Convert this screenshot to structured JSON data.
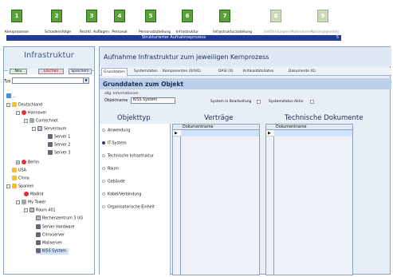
{
  "toolbar": {
    "items": [
      {
        "label": "Kernprozesse",
        "icon": "kernprozesse-icon",
        "enabled": true
      },
      {
        "label": "Schadensfolge",
        "icon": "schadensfolge-icon",
        "enabled": true
      },
      {
        "label": "Rechtl. Auflagen",
        "icon": "auflagen-icon",
        "enabled": true
      },
      {
        "label": "Personal",
        "icon": "personal-icon",
        "enabled": true
      },
      {
        "label": "Personalzuteilung",
        "icon": "personalzuteilung-icon",
        "enabled": true
      },
      {
        "label": "Infrastruktur",
        "icon": "infrastruktur-icon",
        "enabled": true
      },
      {
        "label": "Infrastrukturzuteilung",
        "icon": "infrastrukturzuteilung-icon",
        "enabled": true
      },
      {
        "label": "Gefährdungen/Maßnahmen",
        "icon": "gefaehrdungen-icon",
        "enabled": false
      },
      {
        "label": "Abhängigkeiten",
        "icon": "abhaengigkeiten-icon",
        "enabled": false
      }
    ],
    "subtitle": "Strukturierter Aufnahmeprozess",
    "corner": "5"
  },
  "left_panel": {
    "title": "Infrastruktur",
    "buttons": {
      "neu": "Neu",
      "loeschen": "Löschen",
      "speichern": "Speichern"
    },
    "typ_label": "Typ",
    "typ_value": "",
    "tree": {
      "root": "...",
      "deutschland": "Deutschland",
      "hannover": "Hannover",
      "contechnet": "Contechnet",
      "serverraum": "Serverraum",
      "server1": "Server 1",
      "server2": "Server 2",
      "server3": "Server 3",
      "berlin": "Berlin",
      "usa": "USA",
      "china": "China",
      "spanien": "Spanien",
      "madrid": "Madrid",
      "mytower": "My Tower",
      "raum401": "Raum 401",
      "rechenzentrum": "Rechenzentrum 3 UG",
      "serverhardware": "Server Hardware",
      "citrixserver": "Citrixserver",
      "mailserver": "Mailserver",
      "kiss": "KISS System"
    }
  },
  "main": {
    "title": "Aufnahme Infrastruktur zum jeweiligen Kernprozess",
    "tabs": [
      {
        "label": "Grunddaten",
        "active": true
      },
      {
        "label": "Systemdaten",
        "active": false
      },
      {
        "label": "Komponenten (0/0/0)",
        "active": false
      },
      {
        "label": "DASI (0)",
        "active": false
      },
      {
        "label": "Kritikalitätsdaten",
        "active": false
      },
      {
        "label": "Dokumente (0)",
        "active": false
      }
    ],
    "section": "Grunddaten zum Objekt",
    "allg": "allg. Informationen",
    "objektname_label": "Objektname",
    "objektname_value": "KISS System",
    "in_bearbeitung": "System in Bearbeitung",
    "status_aktiv": "Systemstatus Aktiv",
    "objekttyp_header": "Objekttyp",
    "vertraege_header": "Verträge",
    "techdoc_header": "Technische Dokumente",
    "objekttyp_options": [
      {
        "label": "Anwendung",
        "selected": false
      },
      {
        "label": "IT-System",
        "selected": true
      },
      {
        "label": "Technische Infrastruktur",
        "selected": false
      },
      {
        "label": "Raum",
        "selected": false
      },
      {
        "label": "Gebäude",
        "selected": false
      },
      {
        "label": "Kabel/Verbindung",
        "selected": false
      },
      {
        "label": "Organisatorische Einheit",
        "selected": false
      }
    ],
    "vertraege_col": "Dokumentname",
    "techdoc_col": "Dokumentname"
  },
  "colors": {
    "accent": "#1f3a9a",
    "panel_border": "#8aa3c5",
    "selection": "#cfe4fb"
  }
}
